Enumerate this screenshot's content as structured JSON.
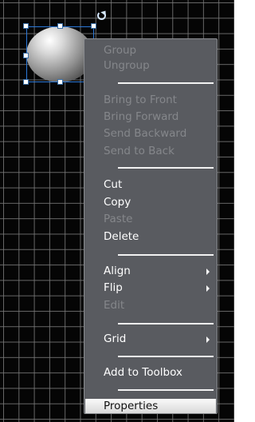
{
  "menu": {
    "group": "Group",
    "ungroup": "Ungroup",
    "bring_to_front": "Bring to Front",
    "bring_forward": "Bring Forward",
    "send_backward": "Send Backward",
    "send_to_back": "Send to Back",
    "cut": "Cut",
    "copy": "Copy",
    "paste": "Paste",
    "delete": "Delete",
    "align": "Align",
    "flip": "Flip",
    "edit": "Edit",
    "grid": "Grid",
    "add_to_toolbox": "Add to Toolbox",
    "properties": "Properties"
  },
  "colors": {
    "canvas_bg": "#050505",
    "grid_line": "#787878",
    "menu_bg": "#595b60",
    "selection": "#2b78d8"
  }
}
